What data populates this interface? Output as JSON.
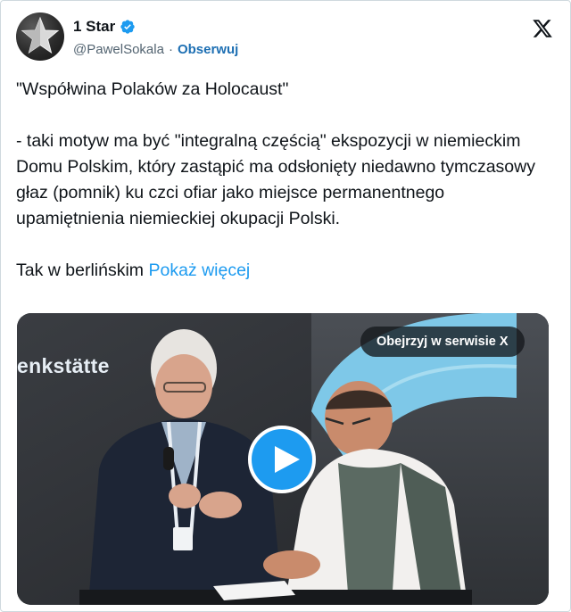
{
  "author": {
    "display_name": "1 Star",
    "handle": "@PawelSokala",
    "separator": "·",
    "follow_label": "Obserwuj",
    "avatar_icon": "star-icon",
    "verified_icon": "verified-badge-icon"
  },
  "brand": {
    "icon": "x-logo-icon"
  },
  "tweet": {
    "line1": "\"Współwina Polaków za Holocaust\"",
    "line2": "- taki motyw ma być \"integralną częścią\" ekspozycji w niemieckim Domu Polskim, który zastąpić ma odsłonięty niedawno tymczasowy głaz (pomnik) ku czci ofiar jako miejsce permanentnego upamiętnienia niemieckiej okupacji Polski.",
    "line3": "Tak w berlińskim",
    "show_more": "Pokaż więcej"
  },
  "media": {
    "venue_sign": "enkstätte",
    "watch_label": "Obejrzyj w serwisie X",
    "play_icon": "play-icon"
  },
  "colors": {
    "link": "#1d9bf0",
    "follow": "#1d6fb3",
    "verified": "#1d9bf0",
    "text": "#0f1419",
    "muted": "#536471"
  }
}
